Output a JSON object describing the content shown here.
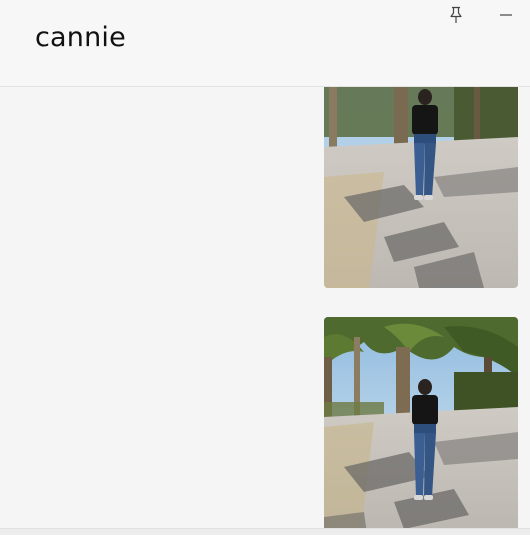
{
  "header": {
    "title": "cannie",
    "pin_icon": "pin-icon",
    "minimize_icon": "minimize-icon"
  },
  "messages": [
    {
      "type": "image",
      "subject": "photo"
    },
    {
      "type": "image",
      "subject": "photo"
    }
  ],
  "colors": {
    "background": "#f5f5f5",
    "header_background": "#f7f7f7",
    "title_text": "#111111",
    "divider": "#e3e3e3"
  }
}
